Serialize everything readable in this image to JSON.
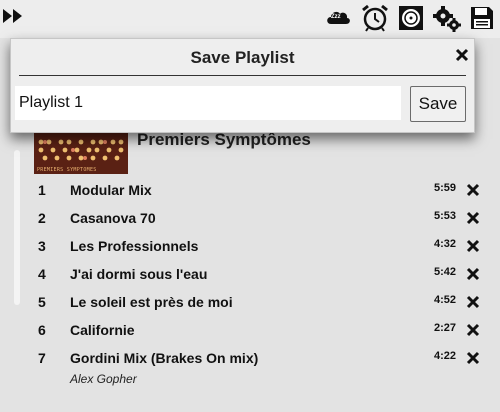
{
  "toolbar": {
    "icons": [
      "fast-forward-icon",
      "sleep-timer-icon",
      "alarm-clock-icon",
      "disk-icon",
      "settings-gears-icon",
      "save-floppy-icon"
    ],
    "sleep_label": "Zzz"
  },
  "dialog": {
    "title": "Save Playlist",
    "input_value": "Playlist 1",
    "save_label": "Save"
  },
  "album": {
    "title": "Premiers Symptômes",
    "art_caption": "PREMIERS SYMPTOMES",
    "artist": "Alex Gopher"
  },
  "tracks": [
    {
      "num": "1",
      "title": "Modular Mix",
      "duration": "5:59"
    },
    {
      "num": "2",
      "title": "Casanova 70",
      "duration": "5:53"
    },
    {
      "num": "3",
      "title": "Les Professionnels",
      "duration": "4:32"
    },
    {
      "num": "4",
      "title": "J'ai dormi sous l'eau",
      "duration": "5:42"
    },
    {
      "num": "5",
      "title": "Le soleil est près de moi",
      "duration": "4:52"
    },
    {
      "num": "6",
      "title": "Californie",
      "duration": "2:27"
    },
    {
      "num": "7",
      "title": "Gordini Mix (Brakes On mix)",
      "duration": "4:22"
    }
  ],
  "colors": {
    "background": "#e3e3e3",
    "dialog_bg": "#eeeeee",
    "album_art": "#5a2114"
  }
}
